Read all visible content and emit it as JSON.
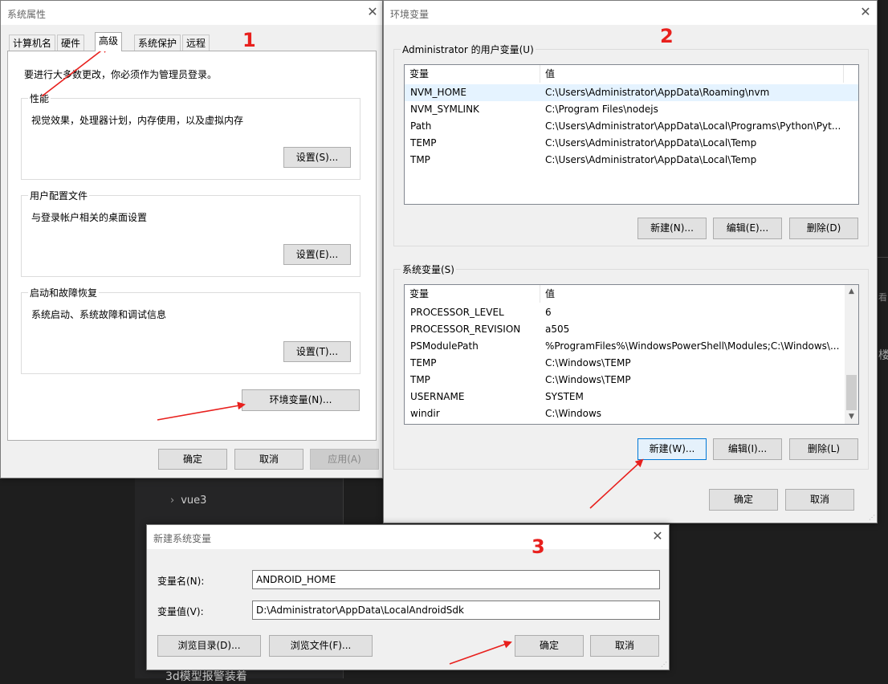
{
  "background": {
    "tree_items": [
      "vue3",
      "3d模型报警装着"
    ],
    "side_fragments": [
      "看",
      "楼"
    ]
  },
  "system_properties": {
    "title": "系统属性",
    "tabs": [
      "计算机名",
      "硬件",
      "高级",
      "系统保护",
      "远程"
    ],
    "active_tab": "高级",
    "admin_note": "要进行大多数更改，你必须作为管理员登录。",
    "performance": {
      "label": "性能",
      "desc": "视觉效果，处理器计划，内存使用，以及虚拟内存",
      "button": "设置(S)..."
    },
    "user_profiles": {
      "label": "用户配置文件",
      "desc": "与登录帐户相关的桌面设置",
      "button": "设置(E)..."
    },
    "startup": {
      "label": "启动和故障恢复",
      "desc": "系统启动、系统故障和调试信息",
      "button": "设置(T)..."
    },
    "env_button": "环境变量(N)...",
    "ok": "确定",
    "cancel": "取消",
    "apply": "应用(A)"
  },
  "env_vars": {
    "title": "环境变量",
    "user_section": "Administrator 的用户变量(U)",
    "columns": [
      "变量",
      "值"
    ],
    "user_vars": [
      {
        "name": "NVM_HOME",
        "value": "C:\\Users\\Administrator\\AppData\\Roaming\\nvm"
      },
      {
        "name": "NVM_SYMLINK",
        "value": "C:\\Program Files\\nodejs"
      },
      {
        "name": "Path",
        "value": "C:\\Users\\Administrator\\AppData\\Local\\Programs\\Python\\Pyt..."
      },
      {
        "name": "TEMP",
        "value": "C:\\Users\\Administrator\\AppData\\Local\\Temp"
      },
      {
        "name": "TMP",
        "value": "C:\\Users\\Administrator\\AppData\\Local\\Temp"
      }
    ],
    "user_buttons": {
      "new": "新建(N)...",
      "edit": "编辑(E)...",
      "delete": "删除(D)"
    },
    "system_section": "系统变量(S)",
    "system_vars": [
      {
        "name": "PROCESSOR_LEVEL",
        "value": "6"
      },
      {
        "name": "PROCESSOR_REVISION",
        "value": "a505"
      },
      {
        "name": "PSModulePath",
        "value": "%ProgramFiles%\\WindowsPowerShell\\Modules;C:\\Windows\\..."
      },
      {
        "name": "TEMP",
        "value": "C:\\Windows\\TEMP"
      },
      {
        "name": "TMP",
        "value": "C:\\Windows\\TEMP"
      },
      {
        "name": "USERNAME",
        "value": "SYSTEM"
      },
      {
        "name": "windir",
        "value": "C:\\Windows"
      }
    ],
    "system_buttons": {
      "new": "新建(W)...",
      "edit": "编辑(I)...",
      "delete": "删除(L)"
    },
    "ok": "确定",
    "cancel": "取消"
  },
  "new_var": {
    "title": "新建系统变量",
    "name_label": "变量名(N):",
    "name_value": "ANDROID_HOME",
    "value_label": "变量值(V):",
    "value_value": "D:\\Administrator\\AppData\\LocalAndroidSdk",
    "browse_dir": "浏览目录(D)...",
    "browse_file": "浏览文件(F)...",
    "ok": "确定",
    "cancel": "取消"
  },
  "annotations": {
    "step1": "1",
    "step2": "2",
    "step3": "3",
    "color": "#e8201d"
  }
}
